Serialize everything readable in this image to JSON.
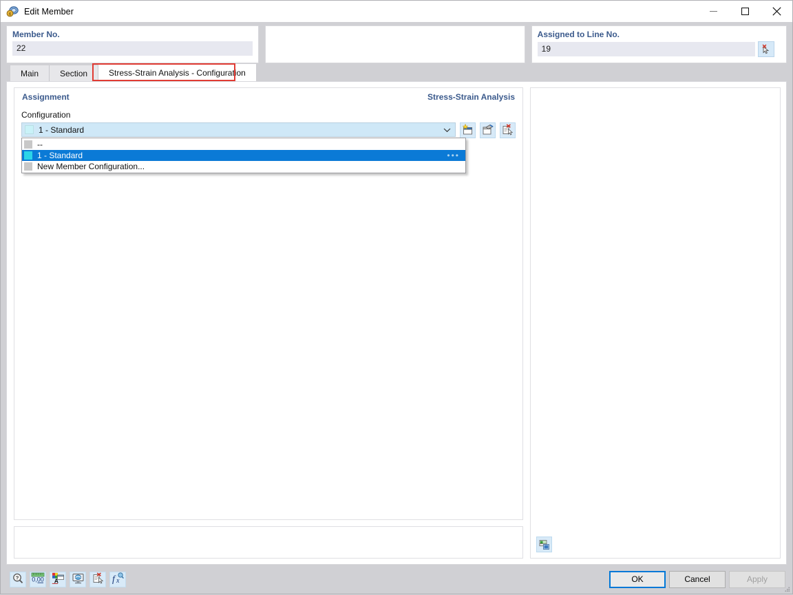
{
  "window": {
    "title": "Edit Member",
    "icon": "member-icon",
    "controls": {
      "minimize": "—",
      "maximize": "□",
      "close": "✕"
    }
  },
  "header": {
    "member": {
      "label": "Member No.",
      "value": "22"
    },
    "middle": {
      "value": ""
    },
    "line": {
      "label": "Assigned to Line No.",
      "value": "19",
      "pick_icon": "pick-cursor-icon"
    }
  },
  "tabs": [
    {
      "label": "Main",
      "active": false
    },
    {
      "label": "Section",
      "active": false
    },
    {
      "label": "Stress-Strain Analysis - Configuration",
      "active": true
    }
  ],
  "content": {
    "section_title": "Assignment",
    "section_title_right": "Stress-Strain Analysis",
    "field_label": "Configuration",
    "combo": {
      "value": "1 - Standard",
      "swatch_color": "#c9f2f8",
      "arrow_icon": "chevron-down-icon"
    },
    "combo_buttons": [
      {
        "name": "new-configuration-button",
        "icon": "new-window-icon"
      },
      {
        "name": "edit-configuration-button",
        "icon": "edit-window-icon"
      },
      {
        "name": "delete-configuration-button",
        "icon": "delete-document-icon"
      }
    ],
    "dropdown": {
      "items": [
        {
          "label": "--",
          "swatch_color": "#c8c8c8",
          "selected": false
        },
        {
          "label": "1 - Standard",
          "swatch_color": "#2bd4e8",
          "selected": true
        },
        {
          "label": "New Member Configuration...",
          "swatch_color": "#c8c8c8",
          "selected": false
        }
      ]
    }
  },
  "right_panel": {
    "render_icon": "render-image-icon"
  },
  "bottom": {
    "tools": [
      {
        "name": "help-magnifier-button",
        "icon": "magnifier-question-icon"
      },
      {
        "name": "units-button",
        "icon": "units-0-00-icon",
        "label": "0,00"
      },
      {
        "name": "display-properties-button",
        "icon": "color-font-icon"
      },
      {
        "name": "view-settings-button",
        "icon": "monitor-icon"
      },
      {
        "name": "delete-button",
        "icon": "delete-document-cursor-icon"
      },
      {
        "name": "formula-button",
        "icon": "fx-formula-icon"
      }
    ],
    "buttons": [
      {
        "name": "ok-button",
        "label": "OK",
        "state": "focused"
      },
      {
        "name": "cancel-button",
        "label": "Cancel",
        "state": "normal"
      },
      {
        "name": "apply-button",
        "label": "Apply",
        "state": "disabled"
      }
    ]
  },
  "colors": {
    "accent": "#0078d7",
    "header_label": "#3b5a8c",
    "tab_highlight": "#e13b33",
    "selected_row": "#0b7ad6"
  }
}
